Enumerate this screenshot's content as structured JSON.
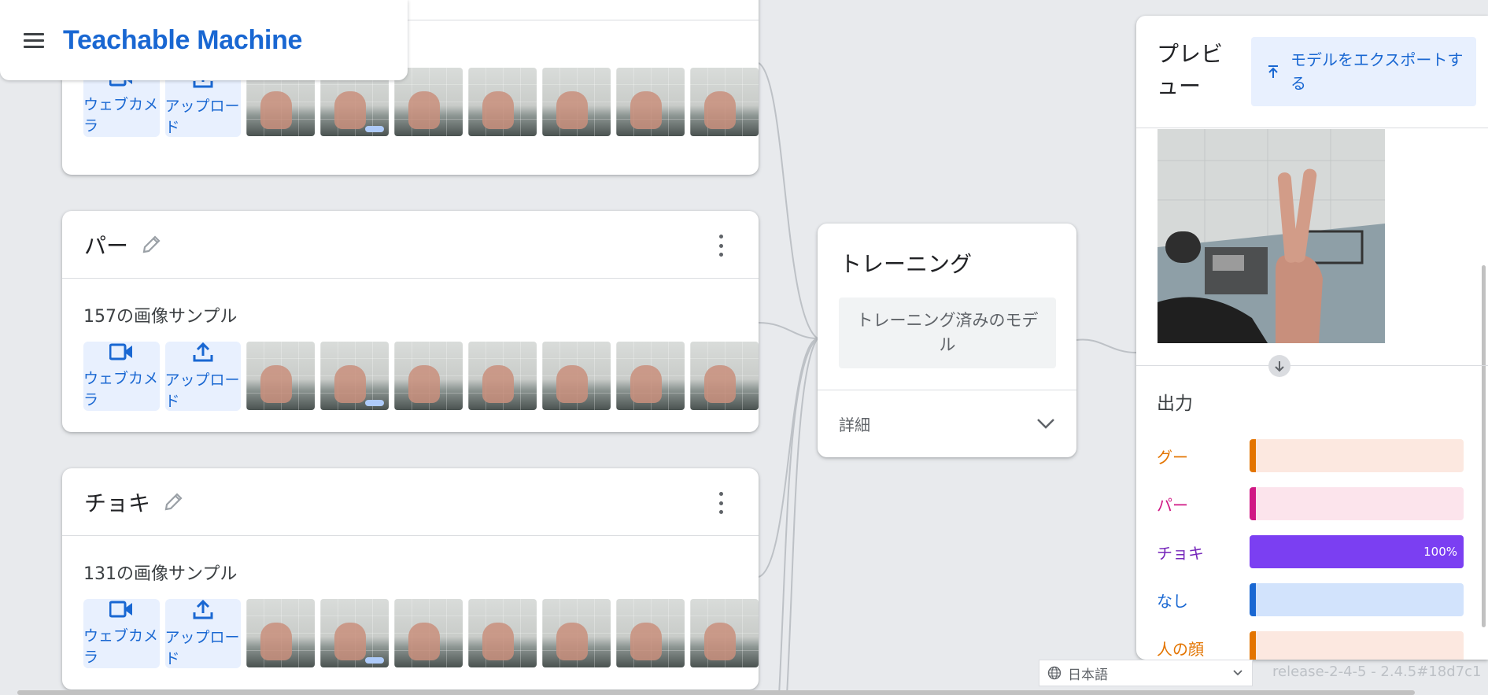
{
  "header": {
    "brand": "Teachable Machine",
    "menu_icon": "menu-icon"
  },
  "classes": [
    {
      "name": "",
      "samples": "",
      "thumbs": 7
    },
    {
      "name": "パー",
      "samples": "157の画像サンプル",
      "thumbs": 7
    },
    {
      "name": "チョキ",
      "samples": "131の画像サンプル",
      "thumbs": 7
    }
  ],
  "sample_buttons": {
    "webcam": "ウェブカメラ",
    "upload": "アップロード"
  },
  "training": {
    "title": "トレーニング",
    "trained_button": "トレーニング済みのモデル",
    "details": "詳細"
  },
  "preview": {
    "title": "プレビュー",
    "export_button": "モデルをエクスポートする",
    "output_title": "出力",
    "outputs": [
      {
        "label": "グー",
        "percent": 0,
        "text_color": "#e37400",
        "bar_color": "#fce8e0",
        "fill_color": "#e37400",
        "value_label": ""
      },
      {
        "label": "パー",
        "percent": 0,
        "text_color": "#d01884",
        "bar_color": "#fce4ec",
        "fill_color": "#d01884",
        "value_label": ""
      },
      {
        "label": "チョキ",
        "percent": 100,
        "text_color": "#7627bb",
        "bar_color": "#eadcf8",
        "fill_color": "#7b3ff2",
        "value_label": "100%"
      },
      {
        "label": "なし",
        "percent": 0,
        "text_color": "#1967d2",
        "bar_color": "#d2e3fc",
        "fill_color": "#1967d2",
        "value_label": ""
      },
      {
        "label": "人の顔",
        "percent": 0,
        "text_color": "#e37400",
        "bar_color": "#fce8e0",
        "fill_color": "#e37400",
        "value_label": ""
      }
    ]
  },
  "language": {
    "selected": "日本語"
  },
  "version": "release-2-4-5 - 2.4.5#18d7c1"
}
